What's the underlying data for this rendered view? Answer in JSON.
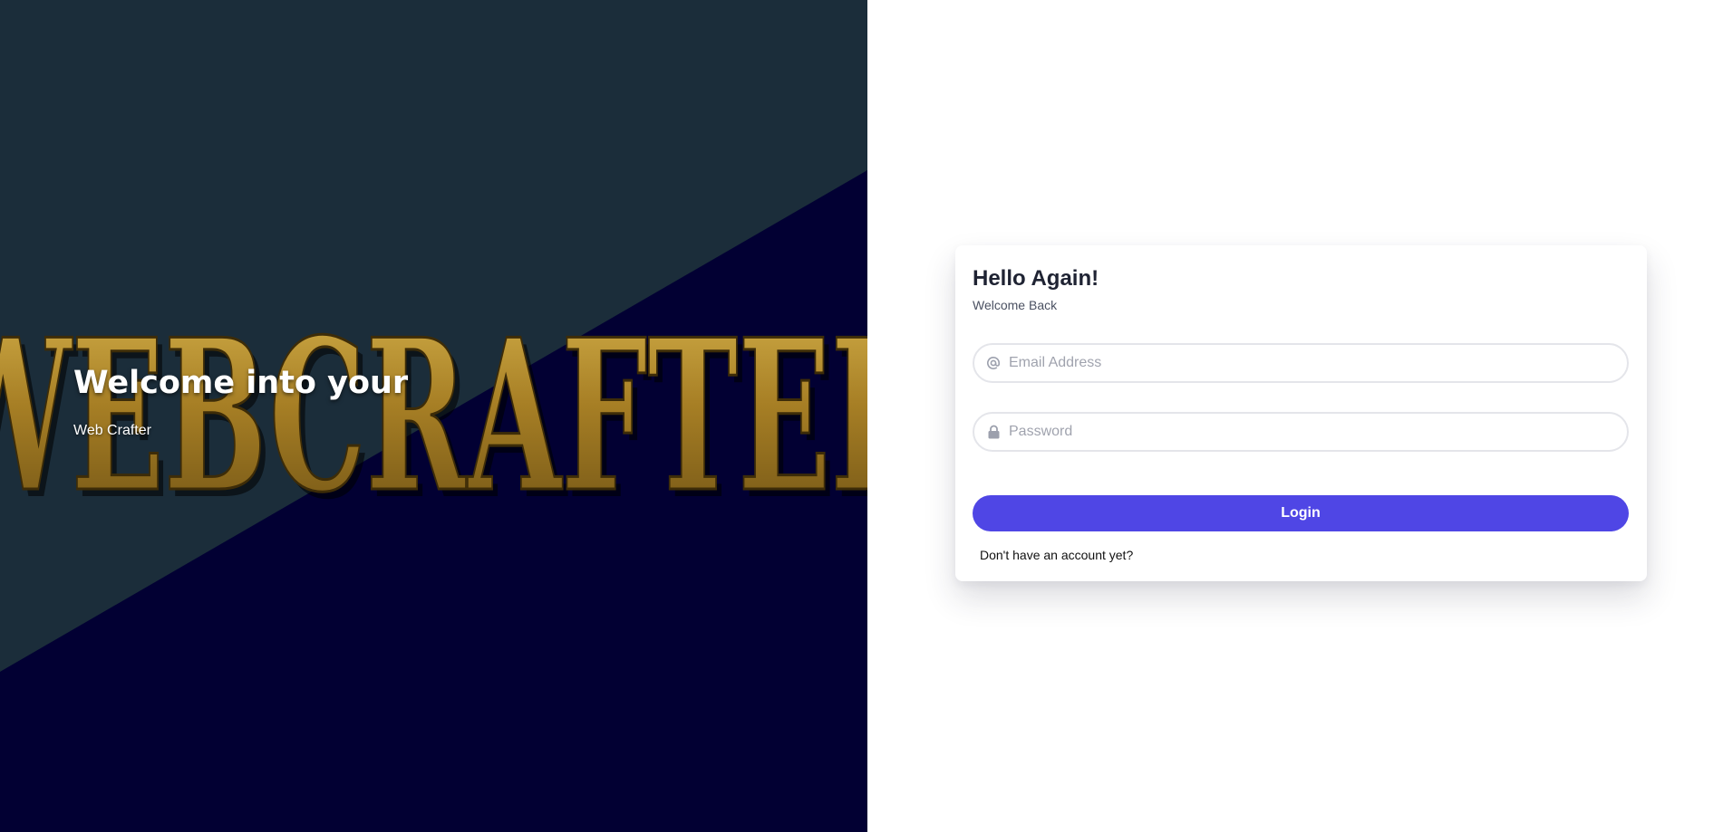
{
  "hero": {
    "logo_text": "WEBCRAFTER",
    "title": "Welcome into your",
    "subtitle": "Web Crafter"
  },
  "login": {
    "title": "Hello Again!",
    "subtitle": "Welcome Back",
    "email_placeholder": "Email Address",
    "email_value": "",
    "password_placeholder": "Password",
    "password_value": "",
    "login_label": "Login",
    "signup_link": "Don't have an account yet?"
  },
  "icons": {
    "email": "at-icon",
    "password": "lock-icon"
  },
  "colors": {
    "hero_top": "#1b2d3a",
    "hero_bottom": "#020033",
    "logo_gold": "#b08a2a",
    "accent": "#4f46e5",
    "field_border": "#e4e5ea",
    "card_bg": "#ffffff"
  }
}
